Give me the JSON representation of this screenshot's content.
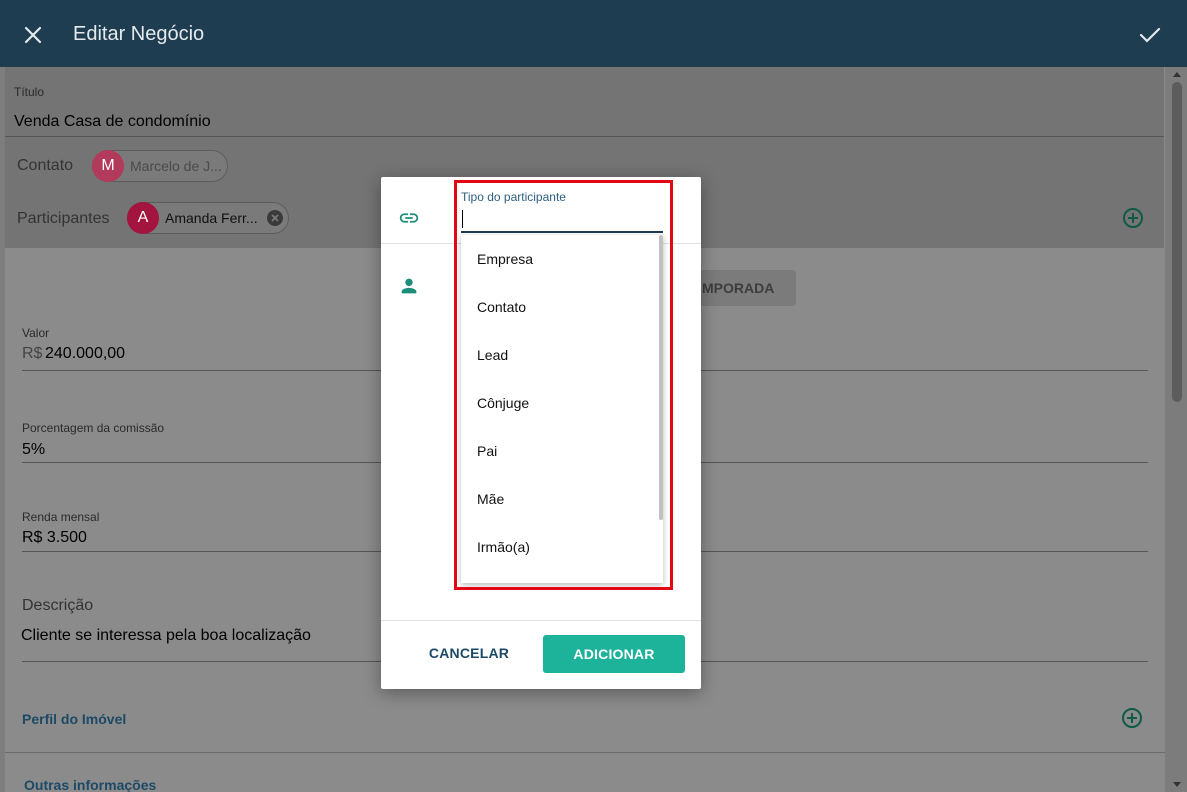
{
  "header": {
    "title": "Editar Negócio"
  },
  "form": {
    "titulo_label": "Título",
    "titulo_value": "Venda Casa de condomínio",
    "contato_label": "Contato",
    "contato_chip": {
      "initial": "M",
      "name": "Marcelo de J...",
      "color": "#b23a5a"
    },
    "participantes_label": "Participantes",
    "participante_chip": {
      "initial": "A",
      "name": "Amanda Ferr...",
      "color": "#a3143f"
    },
    "temporada_tab": "MPORADA",
    "valor_label": "Valor",
    "valor_prefix": "R$",
    "valor_value": "240.000,00",
    "comissao_label": "Porcentagem da comissão",
    "comissao_value": "5%",
    "renda_label": "Renda mensal",
    "renda_value": "R$ 3.500",
    "descricao_label": "Descrição",
    "descricao_value": "Cliente se interessa pela boa localização",
    "perfil_link": "Perfil do Imóvel",
    "outras_link": "Outras informações"
  },
  "dialog": {
    "field_label": "Tipo do participante",
    "field_value": "",
    "options": [
      "Empresa",
      "Contato",
      "Lead",
      "Cônjuge",
      "Pai",
      "Mãe",
      "Irmão(a)"
    ],
    "cancel_label": "CANCELAR",
    "add_label": "ADICIONAR"
  },
  "colors": {
    "header_bg": "#1f3d51",
    "accent_green": "#1db39a",
    "highlight_red": "#e30613",
    "link_blue": "#1c4a66"
  },
  "icons": [
    "close-icon",
    "check-icon",
    "add-circle-icon",
    "link-icon",
    "person-icon",
    "chip-remove-icon"
  ]
}
